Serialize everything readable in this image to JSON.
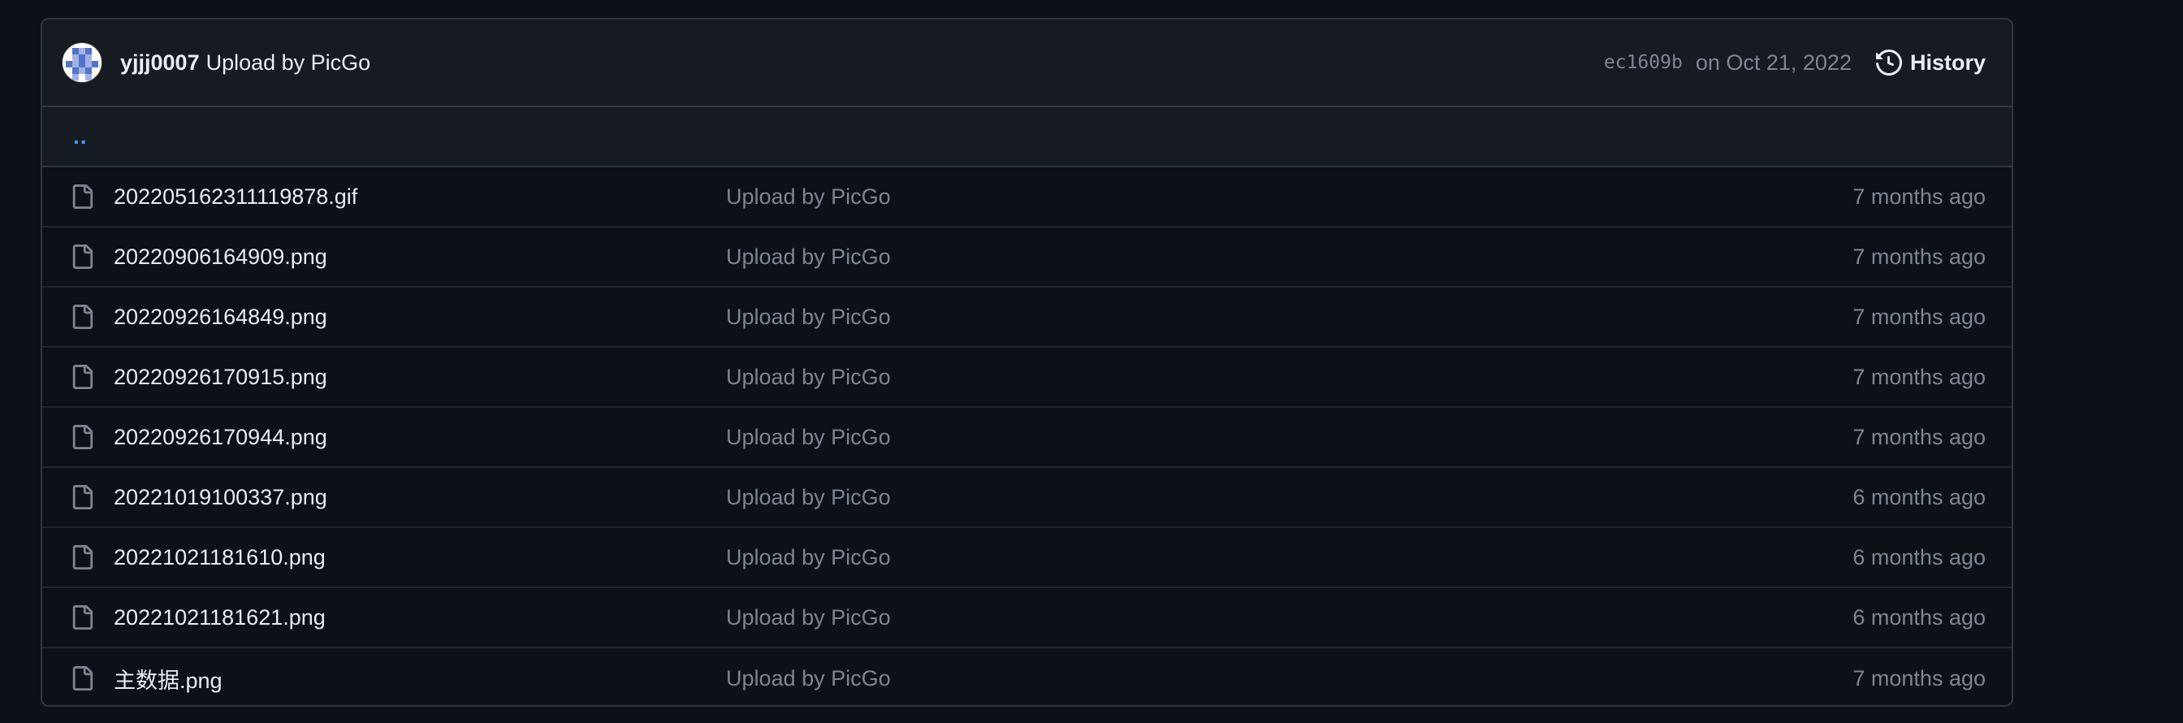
{
  "commit": {
    "author": "yjjj0007",
    "message": "Upload by PicGo",
    "sha": "ec1609b",
    "date": "on Oct 21, 2022",
    "history_label": "History"
  },
  "parent_link": "..",
  "files": [
    {
      "name": "202205162311119878.gif",
      "commit": "Upload by PicGo",
      "age": "7 months ago"
    },
    {
      "name": "20220906164909.png",
      "commit": "Upload by PicGo",
      "age": "7 months ago"
    },
    {
      "name": "20220926164849.png",
      "commit": "Upload by PicGo",
      "age": "7 months ago"
    },
    {
      "name": "20220926170915.png",
      "commit": "Upload by PicGo",
      "age": "7 months ago"
    },
    {
      "name": "20220926170944.png",
      "commit": "Upload by PicGo",
      "age": "7 months ago"
    },
    {
      "name": "20221019100337.png",
      "commit": "Upload by PicGo",
      "age": "6 months ago"
    },
    {
      "name": "20221021181610.png",
      "commit": "Upload by PicGo",
      "age": "6 months ago"
    },
    {
      "name": "20221021181621.png",
      "commit": "Upload by PicGo",
      "age": "6 months ago"
    },
    {
      "name": "主数据.png",
      "commit": "Upload by PicGo",
      "age": "7 months ago"
    }
  ],
  "icons": {
    "avatar": "identicon-avatar",
    "history": "history-icon",
    "file": "file-icon"
  },
  "colors": {
    "background": "#0d1117",
    "header_bg": "#161b22",
    "border": "#30363d",
    "text": "#e6edf3",
    "muted": "#7d8590",
    "link": "#4493f8"
  }
}
